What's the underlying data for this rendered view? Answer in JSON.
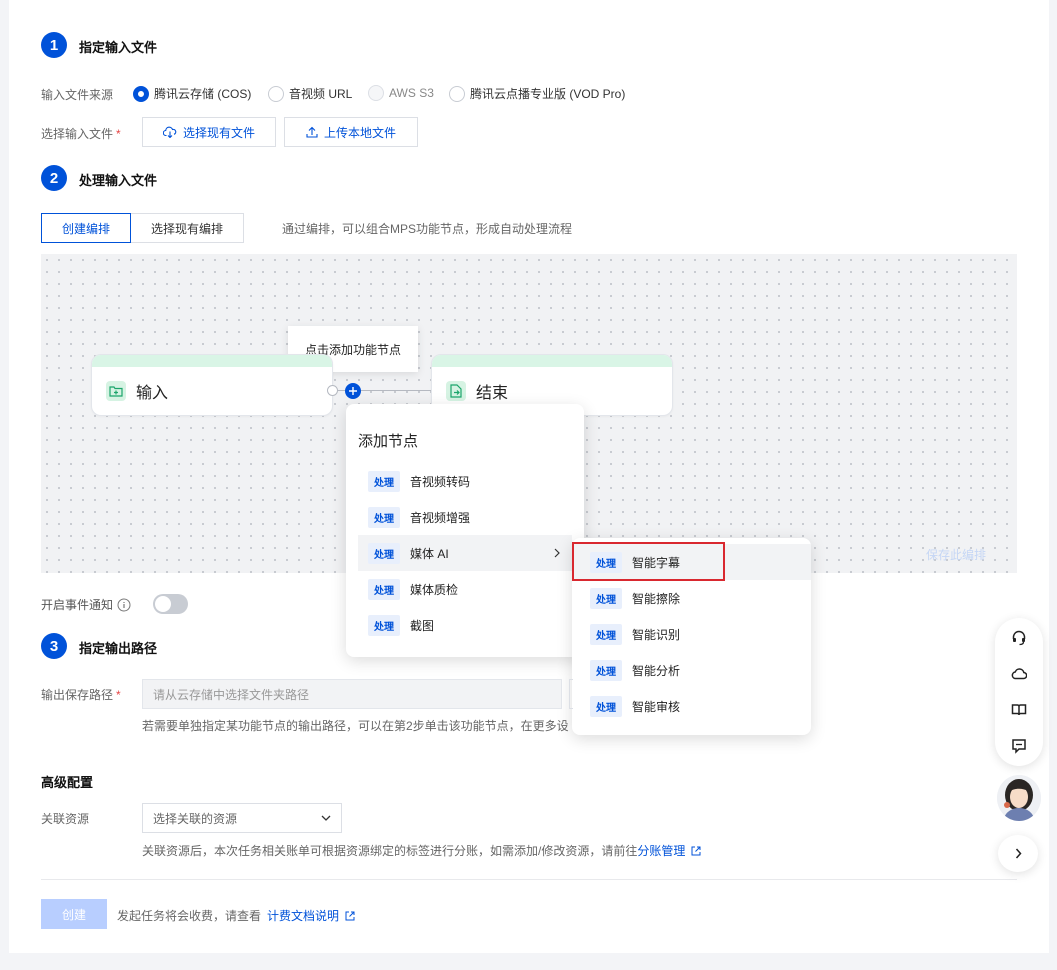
{
  "step1": {
    "number": "1",
    "title": "指定输入文件",
    "source_label": "输入文件来源",
    "radios": [
      {
        "label": "腾讯云存储 (COS)"
      },
      {
        "label": "音视频 URL"
      },
      {
        "label": "AWS S3"
      },
      {
        "label": "腾讯云点播专业版 (VOD Pro)"
      }
    ],
    "select_label": "选择输入文件",
    "required_mark": "*",
    "btn_existing": "选择现有文件",
    "btn_upload": "上传本地文件"
  },
  "step2": {
    "number": "2",
    "title": "处理输入文件",
    "tab_create": "创建编排",
    "tab_existing": "选择现有编排",
    "description": "通过编排，可以组合MPS功能节点，形成自动处理流程",
    "tooltip": "点击添加功能节点",
    "node_input": "输入",
    "node_end": "结束",
    "save_link": "保存此编排",
    "menu": {
      "title": "添加节点",
      "items": [
        {
          "tag": "处理",
          "label": "音视频转码"
        },
        {
          "tag": "处理",
          "label": "音视频增强"
        },
        {
          "tag": "处理",
          "label": "媒体 AI"
        },
        {
          "tag": "处理",
          "label": "媒体质检"
        },
        {
          "tag": "处理",
          "label": "截图"
        }
      ]
    },
    "submenu": {
      "items": [
        {
          "tag": "处理",
          "label": "智能字幕"
        },
        {
          "tag": "处理",
          "label": "智能擦除"
        },
        {
          "tag": "处理",
          "label": "智能识别"
        },
        {
          "tag": "处理",
          "label": "智能分析"
        },
        {
          "tag": "处理",
          "label": "智能审核"
        }
      ]
    }
  },
  "event_notify": {
    "label": "开启事件通知"
  },
  "step3": {
    "number": "3",
    "title": "指定输出路径",
    "path_label": "输出保存路径",
    "required_mark": "*",
    "path_placeholder": "请从云存储中选择文件夹路径",
    "hint": "若需要单独指定某功能节点的输出路径，可以在第2步单击该功能节点，在更多设"
  },
  "advanced": {
    "title": "高级配置",
    "resource_label": "关联资源",
    "resource_placeholder": "选择关联的资源",
    "hint": "关联资源后，本次任务相关账单可根据资源绑定的标签进行分账，如需添加/修改资源，请前往",
    "hint_link": "分账管理"
  },
  "footer": {
    "create_button": "创建",
    "fee_text": "发起任务将会收费，请查看",
    "fee_link": "计费文档说明"
  },
  "colors": {
    "accent": "#0052d9",
    "highlight": "#d9282f"
  }
}
